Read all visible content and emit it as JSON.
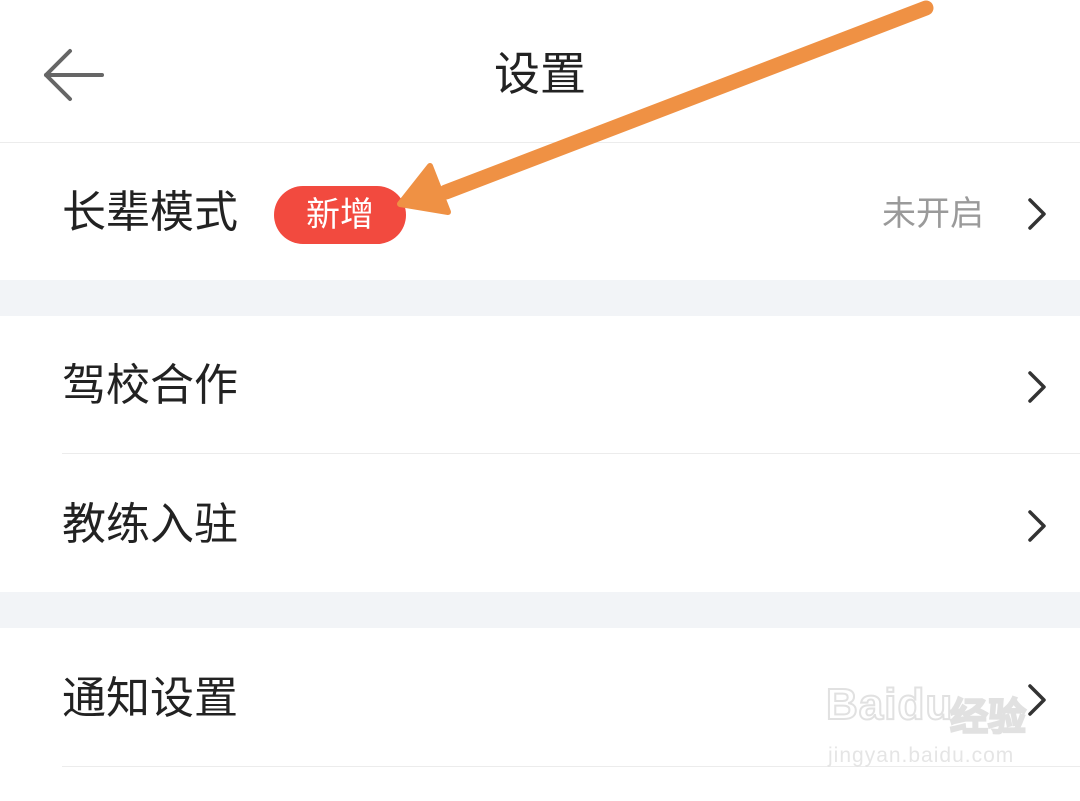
{
  "header": {
    "title": "设置",
    "back_icon": "arrow-left-icon"
  },
  "settings": {
    "elder_mode": {
      "label": "长辈模式",
      "badge": "新增",
      "value": "未开启"
    },
    "driving_school": {
      "label": "驾校合作"
    },
    "coach_join": {
      "label": "教练入驻"
    },
    "notification": {
      "label": "通知设置"
    }
  },
  "watermark": {
    "brand_latin": "Baidu",
    "brand_cn": "经验",
    "url": "jingyan.baidu.com"
  },
  "colors": {
    "badge": "#f24a3f",
    "annotation_arrow": "#ef9144",
    "section_gap": "#f2f4f7",
    "value_text": "#9a9a9a"
  }
}
